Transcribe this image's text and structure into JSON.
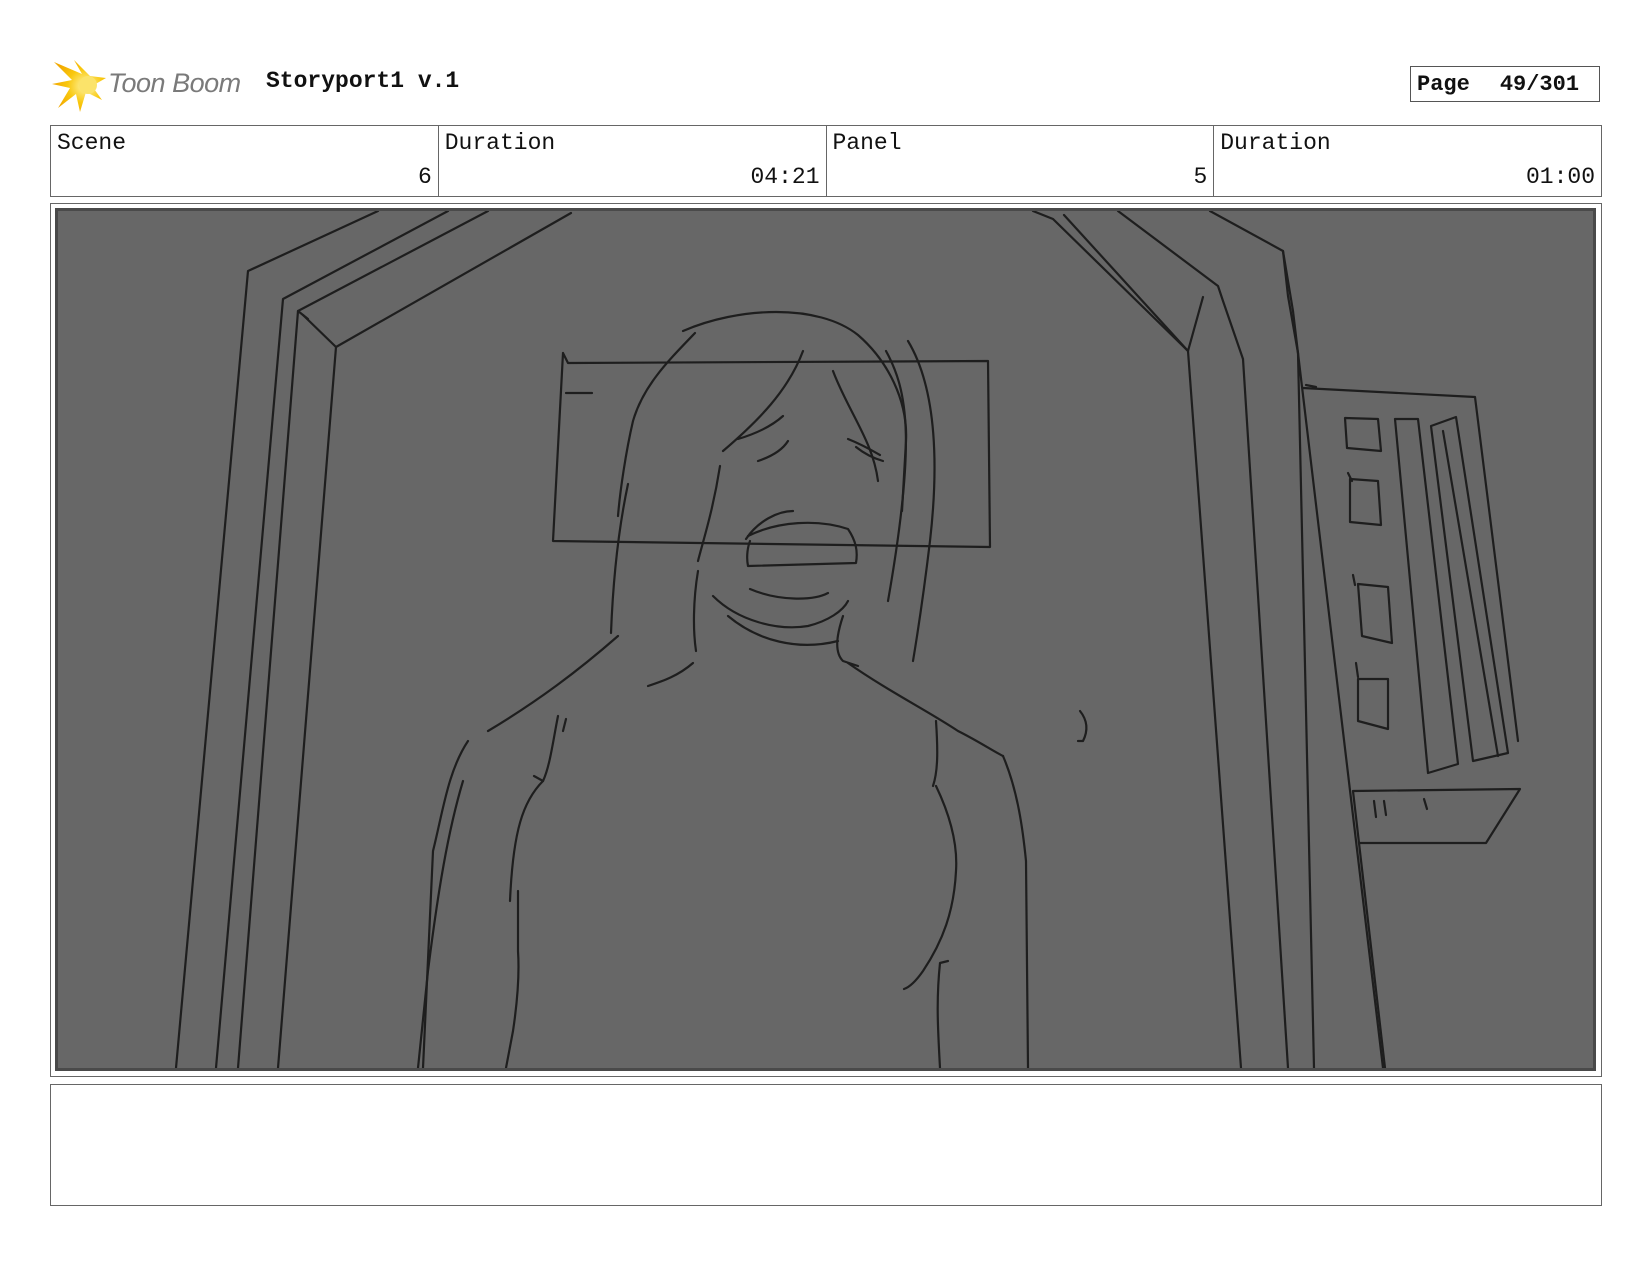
{
  "header": {
    "logo_text": "Toon Boom",
    "logo_icon": "toon-boom-star-icon",
    "document_title": "Storyport1 v.1",
    "page_label": "Page",
    "page_value": "49/301"
  },
  "info": {
    "scene_label": "Scene",
    "scene_value": "6",
    "scene_duration_label": "Duration",
    "scene_duration_value": "04:21",
    "panel_label": "Panel",
    "panel_value": "5",
    "panel_duration_label": "Duration",
    "panel_duration_value": "01:00"
  },
  "panel": {
    "background_color": "#676767",
    "line_color": "#1e1e1e"
  },
  "notes": {
    "text": ""
  }
}
